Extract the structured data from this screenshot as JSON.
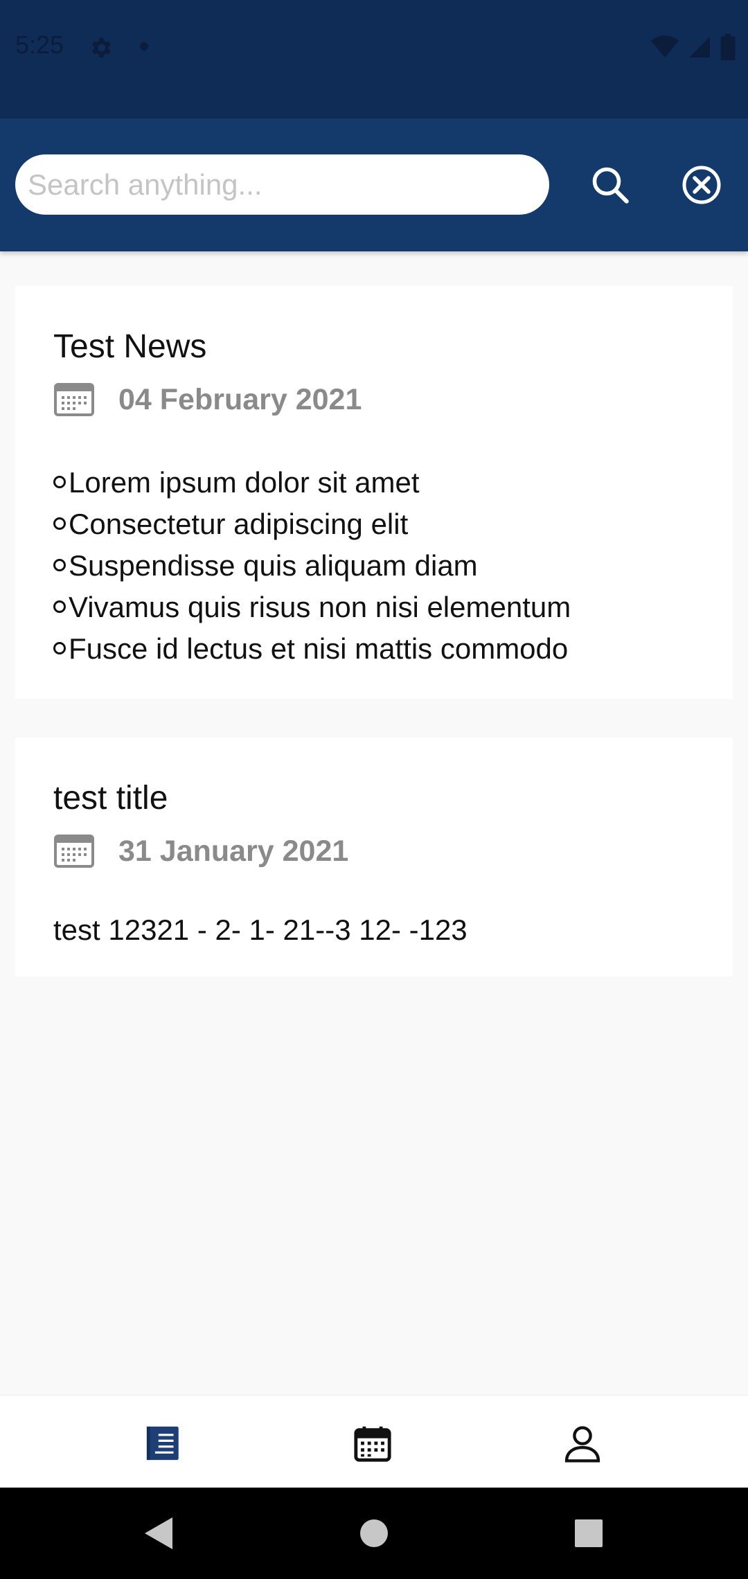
{
  "status_bar": {
    "time": "5:25"
  },
  "search": {
    "placeholder": "Search anything..."
  },
  "news": [
    {
      "title": "Test News",
      "date": "04 February 2021",
      "bullets": [
        "Lorem ipsum dolor sit amet",
        "Consectetur adipiscing elit",
        "Suspendisse quis aliquam diam",
        "Vivamus quis risus non nisi elementum",
        "Fusce id lectus et nisi mattis commodo"
      ]
    },
    {
      "title": "test title",
      "date": "31 January 2021",
      "body": "test 12321 - 2- 1- 21--3 12- -123"
    }
  ],
  "icons": {
    "status": [
      "gear-icon",
      "wifi-icon",
      "signal-icon",
      "battery-icon"
    ],
    "app_bar": [
      "search-icon",
      "close-circle-icon"
    ],
    "bottom_nav": [
      "news-icon",
      "calendar-icon",
      "person-icon"
    ],
    "system_nav": [
      "back-icon",
      "home-icon",
      "recents-icon"
    ]
  },
  "colors": {
    "primary": "#143a6b",
    "status_bar": "#0f2c56",
    "active_nav": "#1d3f74",
    "date_text": "#8a8a8a"
  }
}
